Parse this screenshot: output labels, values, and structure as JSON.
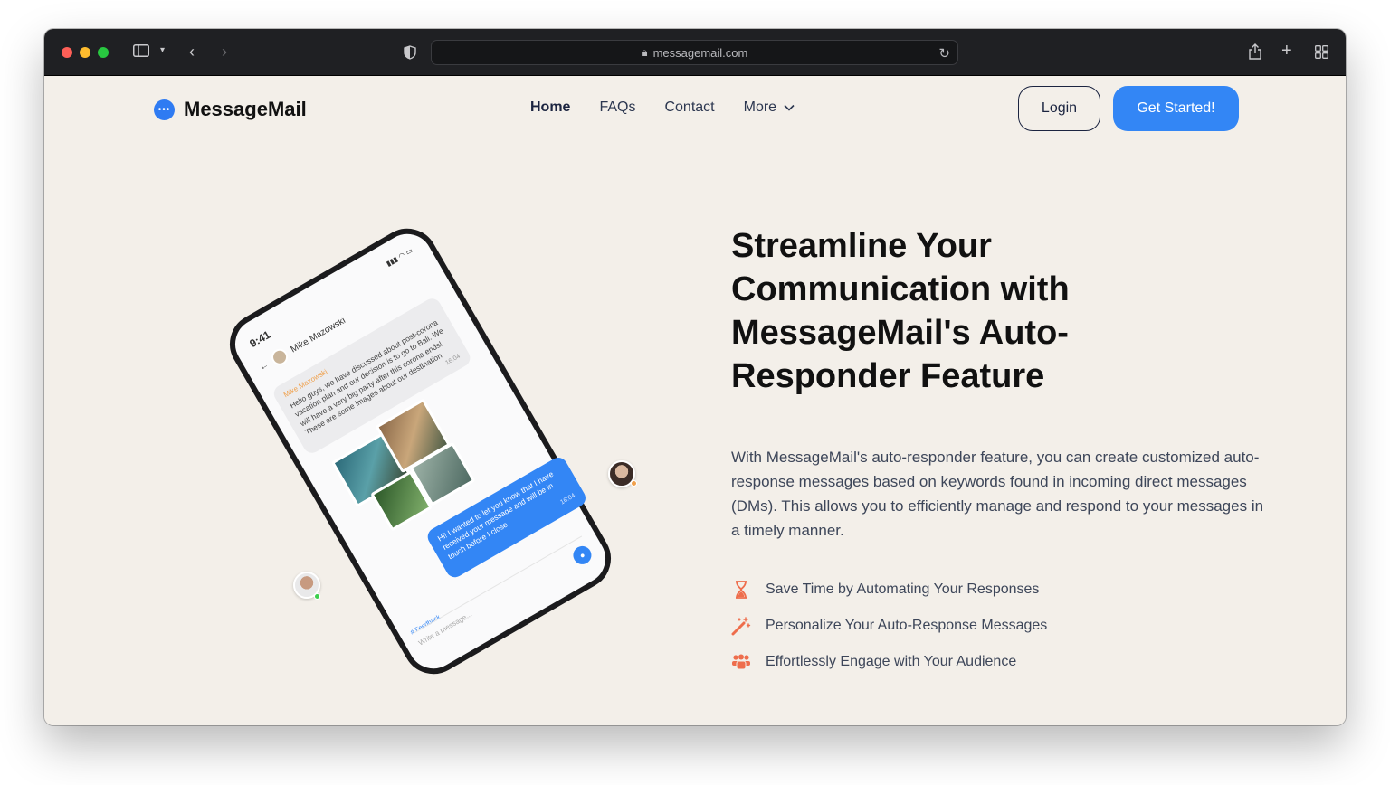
{
  "browser": {
    "url": "messagemail.com"
  },
  "nav": {
    "logo_text": "MessageMail",
    "links": [
      "Home",
      "FAQs",
      "Contact"
    ],
    "more_label": "More",
    "login_label": "Login",
    "cta_label": "Get Started!"
  },
  "phone": {
    "time": "9:41",
    "contact_name": "Mike Mazowski",
    "incoming_sender": "Mike Mazowski",
    "incoming_text": "Hello guys, we have discussed about post-corona vacation plan and our decision is to go to Bali. We will have a very big party after this corona ends! These are some images about our destination",
    "incoming_time": "16:04",
    "outgoing_text": "Hi! I wanted to let you know that I have received your message and will be in touch before I close.",
    "outgoing_time": "16:04",
    "feedback_label": "# Feedback",
    "input_placeholder": "Write a message..."
  },
  "hero": {
    "title": "Streamline Your Communication with MessageMail's Auto-Responder Feature",
    "body": "With MessageMail's auto-responder feature, you can create customized auto-response messages based on keywords found in incoming direct messages (DMs). This allows you to efficiently manage and respond to your messages in a timely manner.",
    "features": [
      {
        "icon": "hourglass-icon",
        "text": "Save Time by Automating Your Responses"
      },
      {
        "icon": "magic-wand-icon",
        "text": "Personalize Your Auto-Response Messages"
      },
      {
        "icon": "users-icon",
        "text": "Effortlessly Engage with Your Audience"
      }
    ]
  },
  "colors": {
    "accent": "#3386f5",
    "page_bg": "#f3efe9",
    "feature_icon": "#ee6d4c"
  }
}
